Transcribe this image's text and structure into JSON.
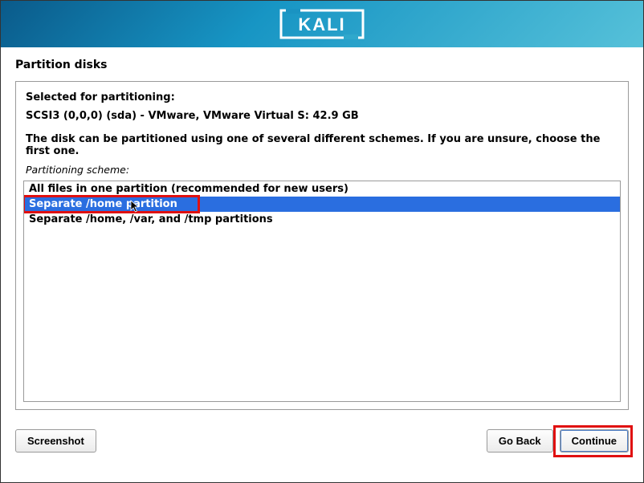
{
  "header": {
    "logo": "KALI"
  },
  "page": {
    "title": "Partition disks",
    "selectedLabel": "Selected for partitioning:",
    "diskInfo": "SCSI3 (0,0,0) (sda) - VMware, VMware Virtual S: 42.9 GB",
    "description": "The disk can be partitioned using one of several different schemes. If you are unsure, choose the first one.",
    "schemeLabel": "Partitioning scheme:",
    "options": [
      "All files in one partition (recommended for new users)",
      "Separate /home partition",
      "Separate /home, /var, and /tmp partitions"
    ],
    "selectedIndex": 1
  },
  "footer": {
    "screenshot": "Screenshot",
    "goBack": "Go Back",
    "continue": "Continue"
  }
}
